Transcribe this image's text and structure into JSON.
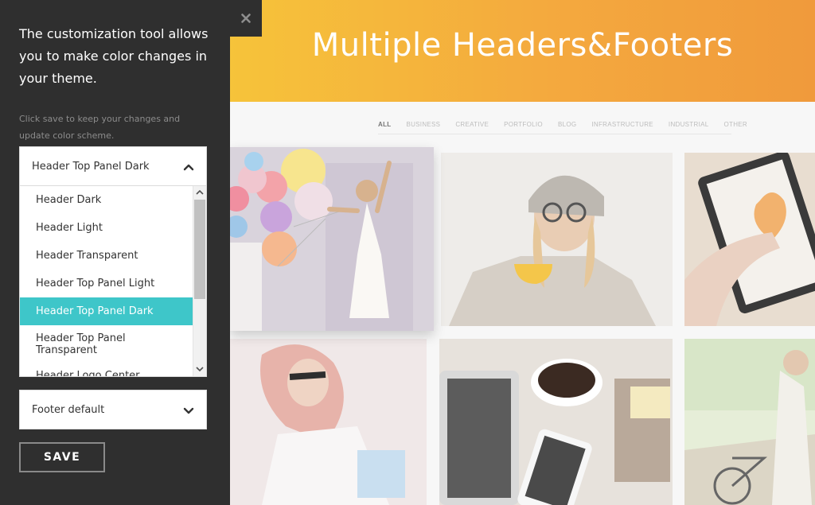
{
  "hero": {
    "title": "Multiple Headers&Footers"
  },
  "filters": [
    "ALL",
    "BUSINESS",
    "CREATIVE",
    "PORTFOLIO",
    "BLOG",
    "INFRASTRUCTURE",
    "INDUSTRIAL",
    "OTHER"
  ],
  "active_filter": "ALL",
  "gallery": [
    {
      "subject": "woman with balloons"
    },
    {
      "subject": "woman in knit hat with mug"
    },
    {
      "subject": "hand drawing heart on tablet"
    },
    {
      "subject": "woman with sunglasses"
    },
    {
      "subject": "coffee cup, tablet and phone on desk"
    },
    {
      "subject": "woman with bicycle"
    }
  ],
  "panel": {
    "intro": "The customization tool allows you to make color changes in your theme.",
    "note": "Click save to keep your changes and update color scheme.",
    "header_select": {
      "value": "Header Top Panel Dark",
      "options": [
        "Header Dark",
        "Header Light",
        "Header Transparent",
        "Header Top Panel Light",
        "Header Top Panel Dark",
        "Header Top Panel Transparent",
        "Header Logo Center"
      ],
      "selected_option": "Header Top Panel Dark",
      "open": true
    },
    "footer_select": {
      "value": "Footer default",
      "open": false
    },
    "save_label": "SAVE"
  },
  "colors": {
    "panel_bg": "#2f2f2f",
    "accent": "#3ec6c9",
    "hero_gradient_start": "#f6c33a",
    "hero_gradient_end": "#f09a3c"
  },
  "icons": {
    "close": "close-icon",
    "caret_up": "chevron-up-icon",
    "caret_down": "chevron-down-icon"
  }
}
